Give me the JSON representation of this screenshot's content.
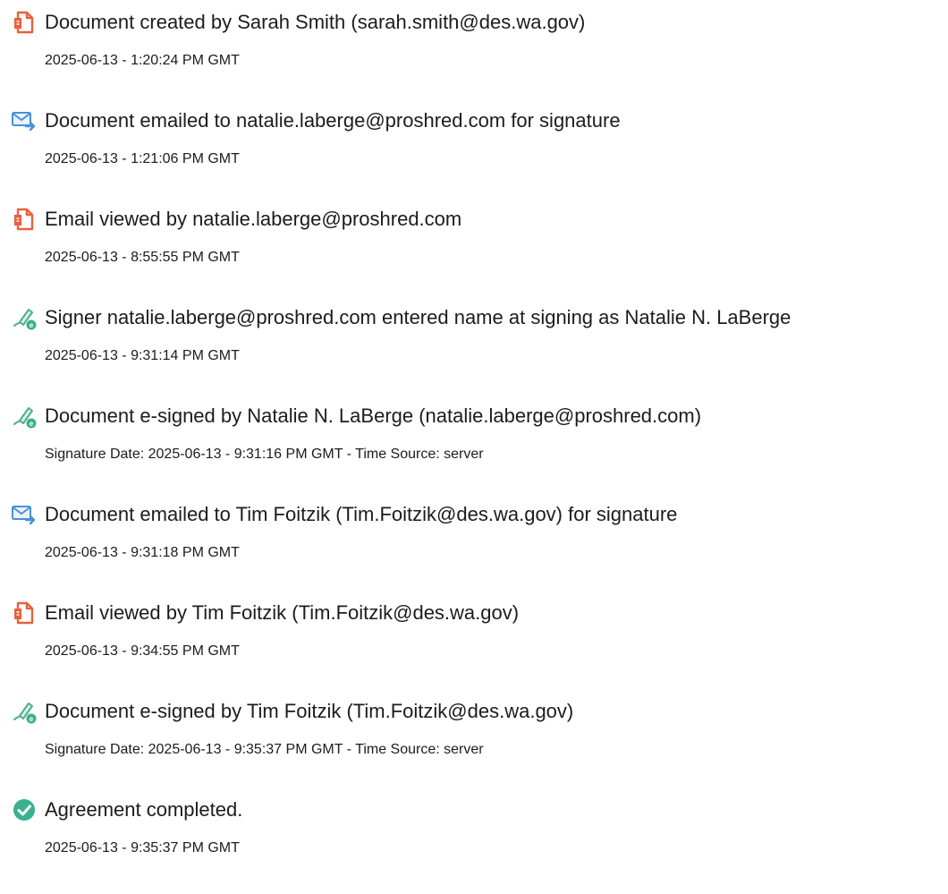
{
  "events": [
    {
      "icon": "document-icon",
      "title": "Document created by Sarah Smith (sarah.smith@des.wa.gov)",
      "subtitle": "2025-06-13 - 1:20:24 PM GMT"
    },
    {
      "icon": "email-sent-icon",
      "title": "Document emailed to natalie.laberge@proshred.com for signature",
      "subtitle": "2025-06-13 - 1:21:06 PM GMT"
    },
    {
      "icon": "document-icon",
      "title": "Email viewed by natalie.laberge@proshred.com",
      "subtitle": "2025-06-13 - 8:55:55 PM GMT"
    },
    {
      "icon": "signature-icon",
      "title": "Signer natalie.laberge@proshred.com entered name at signing as Natalie N. LaBerge",
      "subtitle": "2025-06-13 - 9:31:14 PM GMT"
    },
    {
      "icon": "signature-icon",
      "title": "Document e-signed by Natalie N. LaBerge (natalie.laberge@proshred.com)",
      "subtitle": "Signature Date: 2025-06-13 - 9:31:16 PM GMT - Time Source: server"
    },
    {
      "icon": "email-sent-icon",
      "title": "Document emailed to Tim Foitzik (Tim.Foitzik@des.wa.gov) for signature",
      "subtitle": "2025-06-13 - 9:31:18 PM GMT"
    },
    {
      "icon": "document-icon",
      "title": "Email viewed by Tim Foitzik (Tim.Foitzik@des.wa.gov)",
      "subtitle": "2025-06-13 - 9:34:55 PM GMT"
    },
    {
      "icon": "signature-icon",
      "title": "Document e-signed by Tim Foitzik (Tim.Foitzik@des.wa.gov)",
      "subtitle": "Signature Date: 2025-06-13 - 9:35:37 PM GMT - Time Source: server"
    },
    {
      "icon": "check-circle-icon",
      "title": "Agreement completed.",
      "subtitle": "2025-06-13 - 9:35:37 PM GMT"
    }
  ],
  "colors": {
    "document_icon": "#e8603c",
    "email_icon": "#4a90d9",
    "signature_icon": "#4caf8c",
    "check_icon": "#3bb08f"
  }
}
